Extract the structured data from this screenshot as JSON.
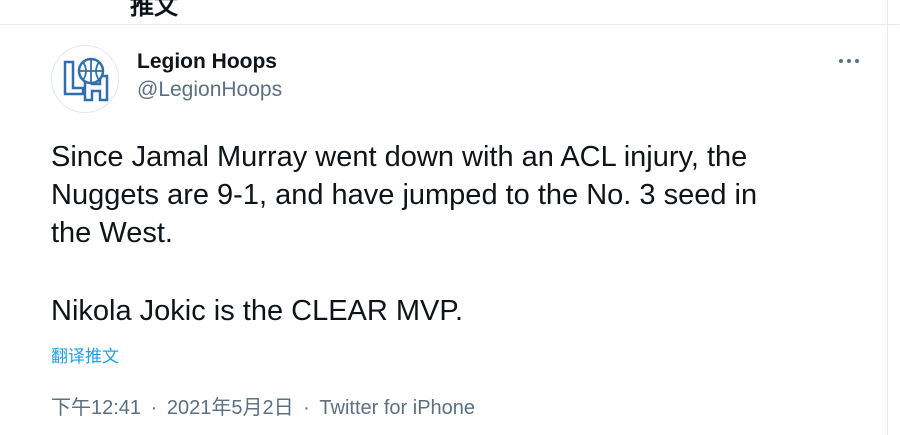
{
  "header": {
    "title": "推文"
  },
  "author": {
    "display_name": "Legion Hoops",
    "handle": "@LegionHoops",
    "avatar_icon": "legion-hoops-logo"
  },
  "tweet": {
    "lines": [
      "Since Jamal Murray went down with an ACL injury, the",
      "Nuggets are 9-1, and have jumped to the No. 3 seed in",
      "the West."
    ],
    "second_paragraph": "Nikola Jokic is the CLEAR MVP.",
    "translate_label": "翻译推文"
  },
  "meta": {
    "time": "下午12:41",
    "separator": "·",
    "date": "2021年5月2日",
    "source": "Twitter for iPhone"
  },
  "colors": {
    "link": "#1da1f2",
    "secondary_text": "#5b7083",
    "primary_text": "#0f1419",
    "logo_blue": "#2f6fb0"
  }
}
